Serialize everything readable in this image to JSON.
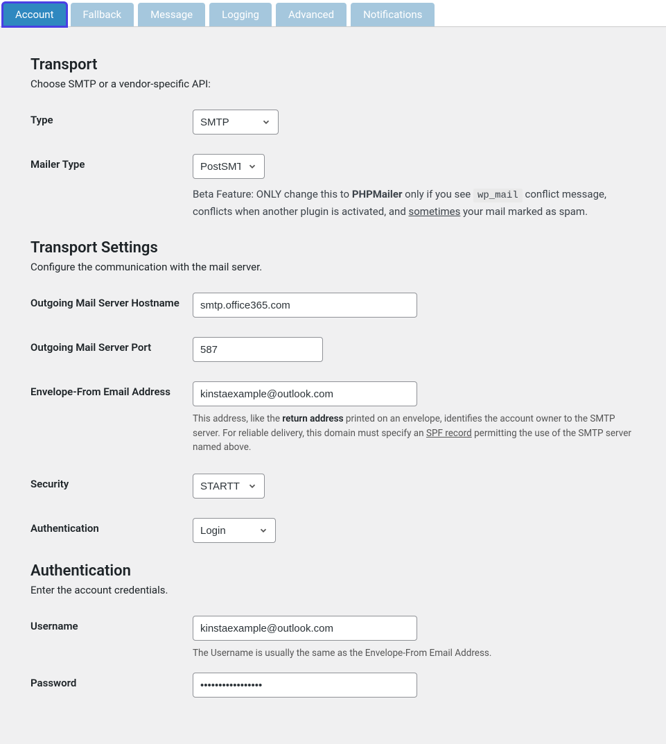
{
  "tabs": {
    "account": "Account",
    "fallback": "Fallback",
    "message": "Message",
    "logging": "Logging",
    "advanced": "Advanced",
    "notifications": "Notifications"
  },
  "transport": {
    "heading": "Transport",
    "desc": "Choose SMTP or a vendor-specific API:",
    "type_label": "Type",
    "type_value": "SMTP",
    "mailer_label": "Mailer Type",
    "mailer_value": "PostSMTP",
    "mailer_help_prefix": "Beta Feature: ONLY change this to ",
    "mailer_help_bold": "PHPMailer",
    "mailer_help_mid1": " only if you see ",
    "mailer_help_code": "wp_mail",
    "mailer_help_mid2": " conflict message, conflicts when another plugin is activated, and ",
    "mailer_help_under": "sometimes",
    "mailer_help_suffix": " your mail marked as spam."
  },
  "settings": {
    "heading": "Transport Settings",
    "desc": "Configure the communication with the mail server.",
    "host_label": "Outgoing Mail Server Hostname",
    "host_value": "smtp.office365.com",
    "port_label": "Outgoing Mail Server Port",
    "port_value": "587",
    "envelope_label": "Envelope-From Email Address",
    "envelope_value": "kinstaexample@outlook.com",
    "envelope_help_prefix": "This address, like the ",
    "envelope_help_bold": "return address",
    "envelope_help_mid": " printed on an envelope, identifies the account owner to the SMTP server. For reliable delivery, this domain must specify an ",
    "envelope_help_under": "SPF record",
    "envelope_help_suffix": " permitting the use of the SMTP server named above.",
    "security_label": "Security",
    "security_value": "STARTTLS",
    "auth_label": "Authentication",
    "auth_value": "Login"
  },
  "auth": {
    "heading": "Authentication",
    "desc": "Enter the account credentials.",
    "username_label": "Username",
    "username_value": "kinstaexample@outlook.com",
    "username_help": "The Username is usually the same as the Envelope-From Email Address.",
    "password_label": "Password",
    "password_value": "•••••••••••••••••"
  }
}
